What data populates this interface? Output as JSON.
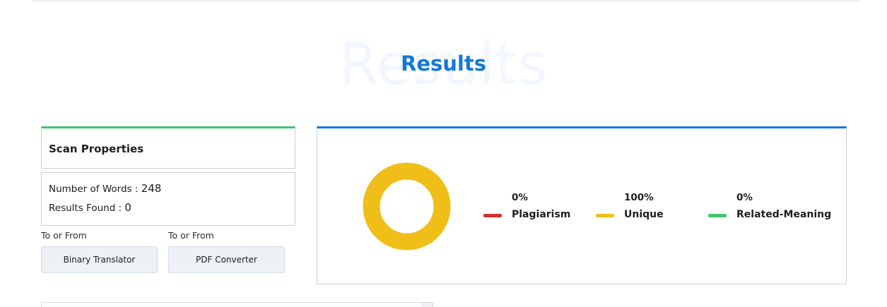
{
  "results": {
    "watermark": "Results",
    "title": "Results"
  },
  "scan_properties": {
    "title": "Scan Properties",
    "words_label": "Number of Words : ",
    "words_value": "248",
    "found_label": "Results Found : ",
    "found_value": "0"
  },
  "tools": [
    {
      "caption": "To or From",
      "label": "Binary Translator"
    },
    {
      "caption": "To or From",
      "label": "PDF Converter"
    }
  ],
  "summary": [
    {
      "percent": "0%",
      "label": "Plagiarism",
      "value": 0,
      "color": "#d32f2f"
    },
    {
      "percent": "100%",
      "label": "Unique",
      "value": 100,
      "color": "#f0be18"
    },
    {
      "percent": "0%",
      "label": "Related-Meaning",
      "value": 0,
      "color": "#3ec56e"
    }
  ],
  "colors": {
    "accent_blue": "#1478d8",
    "accent_green": "#3ec56e",
    "unique_yellow": "#f0be18"
  }
}
